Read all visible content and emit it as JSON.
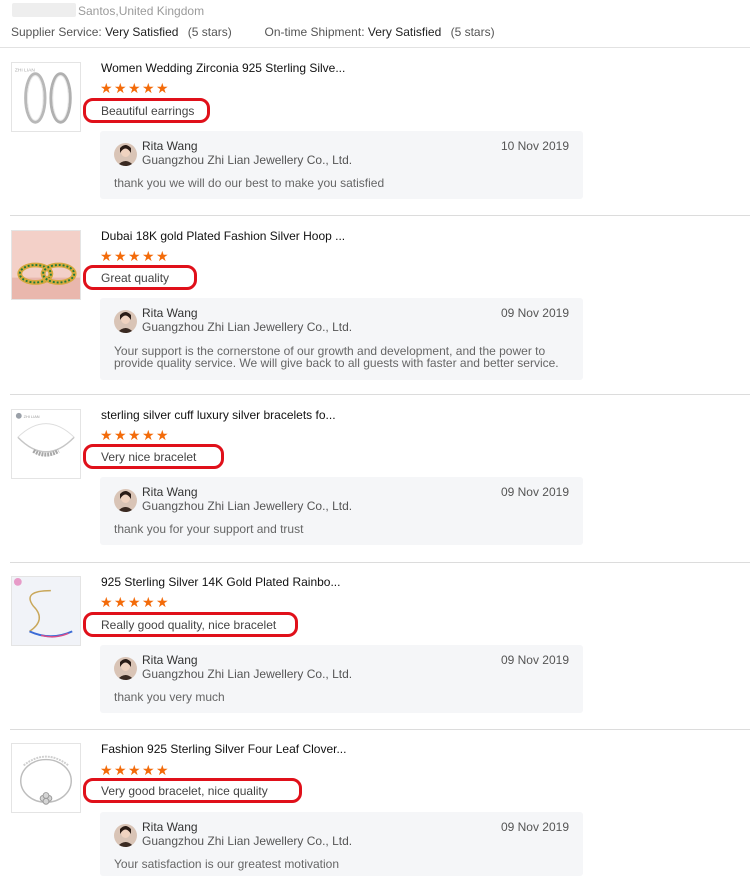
{
  "header": {
    "location": "Santos,United Kingdom",
    "supplier_service_label": "Supplier Service:",
    "supplier_service_value": "Very Satisfied",
    "supplier_service_stars": "(5 stars)",
    "shipment_label": "On-time Shipment:",
    "shipment_value": "Very Satisfied",
    "shipment_stars": "(5 stars)"
  },
  "star_glyph": "★",
  "accent_color": "#f36b0a",
  "highlight_color": "#e0101a",
  "reviews": [
    {
      "product_title": "Women Wedding Zirconia 925 Sterling Silve...",
      "rating": 5,
      "comment": "Beautiful earrings",
      "thumb": "hoop-earrings-image",
      "reply": {
        "name": "Rita Wang",
        "company": "Guangzhou Zhi Lian Jewellery Co., Ltd.",
        "date": "10 Nov 2019",
        "text": "thank you we will do our best to make you satisfied"
      }
    },
    {
      "product_title": "Dubai 18K gold Plated Fashion Silver Hoop ...",
      "rating": 5,
      "comment": "Great quality",
      "thumb": "gold-hoop-image",
      "reply": {
        "name": "Rita Wang",
        "company": "Guangzhou Zhi Lian Jewellery Co., Ltd.",
        "date": "09 Nov 2019",
        "text": "Your support is the cornerstone of our growth and development, and the power to provide quality service. We will give back to all guests with faster and better service."
      }
    },
    {
      "product_title": "sterling silver cuff luxury silver bracelets fo...",
      "rating": 5,
      "comment": "Very nice bracelet",
      "thumb": "silver-bracelet-image",
      "reply": {
        "name": "Rita Wang",
        "company": "Guangzhou Zhi Lian Jewellery Co., Ltd.",
        "date": "09 Nov 2019",
        "text": "thank you for your support and trust"
      }
    },
    {
      "product_title": "925 Sterling Silver 14K Gold Plated Rainbo...",
      "rating": 5,
      "comment": "Really good quality, nice bracelet",
      "thumb": "rainbow-bracelet-image",
      "reply": {
        "name": "Rita Wang",
        "company": "Guangzhou Zhi Lian Jewellery Co., Ltd.",
        "date": "09 Nov 2019",
        "text": "thank you very much"
      }
    },
    {
      "product_title": "Fashion 925 Sterling Silver Four Leaf Clover...",
      "rating": 5,
      "comment": "Very good bracelet, nice quality",
      "thumb": "clover-bracelet-image",
      "reply": {
        "name": "Rita Wang",
        "company": "Guangzhou Zhi Lian Jewellery Co., Ltd.",
        "date": "09 Nov 2019",
        "text": "Your satisfaction is our greatest motivation"
      }
    }
  ]
}
